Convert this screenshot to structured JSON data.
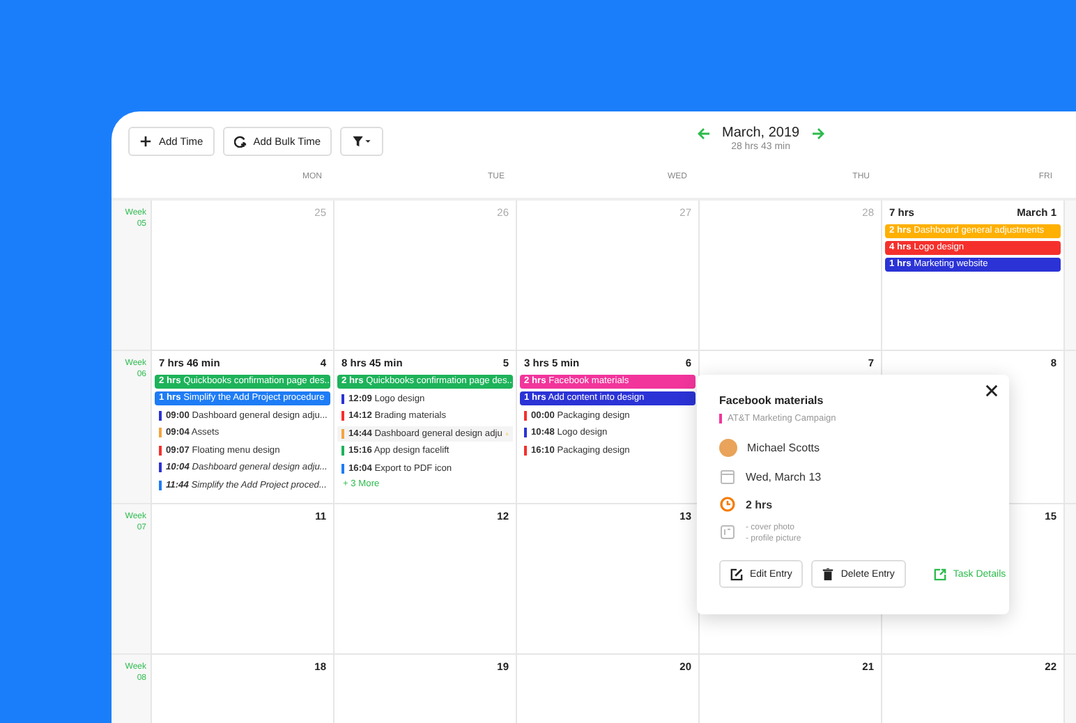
{
  "toolbar": {
    "buttons": [
      {
        "kind": "add",
        "label": "Add Time"
      },
      {
        "kind": "bulk",
        "label": "Add Bulk Time"
      },
      {
        "kind": "filter"
      }
    ]
  },
  "period": {
    "title": "March, 2019",
    "total": "28 hrs 43 min"
  },
  "weekdays": [
    "MON",
    "TUE",
    "WED",
    "THU",
    "FRI"
  ],
  "weeks": [
    {
      "label": "Week 05",
      "days": [
        {
          "date": "25",
          "muted": true
        },
        {
          "date": "26",
          "muted": true
        },
        {
          "date": "27",
          "muted": true
        },
        {
          "date": "28",
          "muted": true
        },
        {
          "date": "March 1",
          "muted": false,
          "total": "7 hrs",
          "entries": [
            {
              "kind": "block",
              "duration": "2 hrs",
              "title": "Dashboard general adjustments",
              "color": "#ffb000"
            },
            {
              "kind": "block",
              "duration": "4 hrs",
              "title": "Logo design",
              "color": "#f5302c"
            },
            {
              "kind": "block",
              "duration": "1 hrs",
              "title": "Marketing website",
              "color": "#2b33d6"
            }
          ]
        }
      ]
    },
    {
      "label": "Week 06",
      "days": [
        {
          "date": "4",
          "muted": false,
          "total": "7 hrs 46 min",
          "entries": [
            {
              "kind": "block",
              "duration": "2 hrs",
              "title": "Quickbooks confirmation page des...",
              "color": "#1db35a"
            },
            {
              "kind": "block",
              "duration": "1 hrs",
              "title": "Simplify the Add Project procedure",
              "color": "#1e7cf5"
            },
            {
              "kind": "entry",
              "time": "09:00",
              "title": "Dashboard general design adju...",
              "color": "#2b33d6"
            },
            {
              "kind": "entry",
              "time": "09:04",
              "title": "Assets",
              "color": "#f4a340"
            },
            {
              "kind": "entry",
              "time": "09:07",
              "title": "Floating menu design",
              "color": "#f5302c"
            },
            {
              "kind": "planned",
              "time": "10:04",
              "title": "Dashboard general design adju...",
              "color": "#2b33d6"
            },
            {
              "kind": "planned",
              "time": "11:44",
              "title": "Simplify the Add Project proced...",
              "color": "#1e7cf5"
            }
          ]
        },
        {
          "date": "5",
          "muted": false,
          "total": "8 hrs 45 min",
          "more": "+ 3 More",
          "entries": [
            {
              "kind": "block",
              "duration": "2 hrs",
              "title": "Quickbooks confirmation page des...",
              "color": "#1db35a"
            },
            {
              "kind": "entry",
              "time": "12:09",
              "title": "Logo design",
              "color": "#2b33d6"
            },
            {
              "kind": "entry",
              "time": "14:12",
              "title": "Brading materials",
              "color": "#f5302c"
            },
            {
              "kind": "hovered",
              "time": "14:44",
              "title": "Dashboard general design adju",
              "color": "#f4a340"
            },
            {
              "kind": "entry",
              "time": "15:16",
              "title": "App design facelift",
              "color": "#1db35a"
            },
            {
              "kind": "entry",
              "time": "16:04",
              "title": "Export to PDF icon",
              "color": "#1e7cf5"
            }
          ]
        },
        {
          "date": "6",
          "muted": false,
          "total": "3 hrs 5 min",
          "entries": [
            {
              "kind": "block",
              "duration": "2 hrs",
              "title": "Facebook materials",
              "color": "#f2359b"
            },
            {
              "kind": "block",
              "duration": "1 hrs",
              "title": "Add content into design",
              "color": "#2b33d6"
            },
            {
              "kind": "entry",
              "time": "00:00",
              "title": "Packaging design",
              "color": "#f5302c"
            },
            {
              "kind": "entry",
              "time": "10:48",
              "title": "Logo design",
              "color": "#2b33d6"
            },
            {
              "kind": "entry",
              "time": "16:10",
              "title": "Packaging design",
              "color": "#f5302c"
            }
          ]
        },
        {
          "date": "7",
          "muted": false
        },
        {
          "date": "8",
          "muted": false
        }
      ]
    },
    {
      "label": "Week 07",
      "days": [
        {
          "date": "11",
          "muted": false
        },
        {
          "date": "12",
          "muted": false
        },
        {
          "date": "13",
          "muted": false
        },
        {
          "covered": true
        },
        {
          "date": "15",
          "muted": false
        }
      ]
    },
    {
      "label": "Week 08",
      "days": [
        {
          "date": "18",
          "muted": false
        },
        {
          "date": "19",
          "muted": false
        },
        {
          "date": "20",
          "muted": false
        },
        {
          "date": "21",
          "muted": false
        },
        {
          "date": "22",
          "muted": false
        }
      ]
    }
  ],
  "popover": {
    "title": "Facebook materials",
    "project": "AT&T Marketing Campaign",
    "user": "Michael Scotts",
    "date": "Wed, March 13",
    "duration": "2 hrs",
    "notes": [
      "- cover photo",
      "- profile picture"
    ],
    "actions": [
      {
        "kind": "edit",
        "label": "Edit Entry"
      },
      {
        "kind": "delete",
        "label": "Delete Entry"
      },
      {
        "kind": "link",
        "label": "Task Details"
      }
    ]
  }
}
